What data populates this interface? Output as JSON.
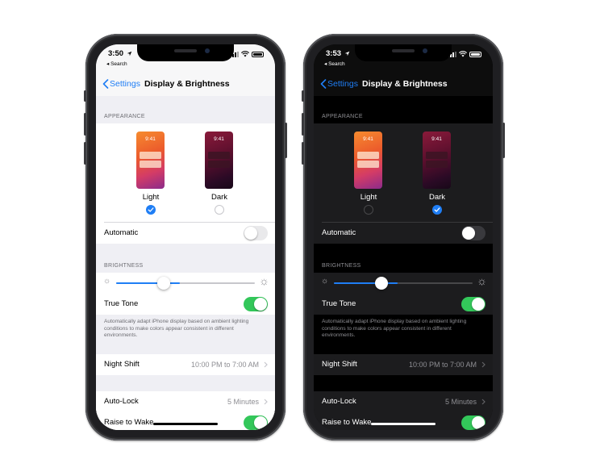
{
  "phones": [
    {
      "theme": "light",
      "status": {
        "time": "3:50",
        "back_app": "◂ Search"
      },
      "nav": {
        "back_label": "Settings",
        "title": "Display & Brightness"
      },
      "appearance": {
        "header": "APPEARANCE",
        "light_label": "Light",
        "dark_label": "Dark",
        "thumb_time": "9:41",
        "selected": "Light"
      },
      "automatic": {
        "label": "Automatic",
        "on": false
      },
      "brightness": {
        "header": "BRIGHTNESS",
        "level": 0.46
      },
      "true_tone": {
        "label": "True Tone",
        "on": true,
        "footer": "Automatically adapt iPhone display based on ambient lighting conditions to make colors appear consistent in different environments."
      },
      "night_shift": {
        "label": "Night Shift",
        "value": "10:00 PM to 7:00 AM"
      },
      "auto_lock": {
        "label": "Auto-Lock",
        "value": "5 Minutes"
      },
      "raise_to_wake": {
        "label": "Raise to Wake",
        "on": true
      }
    },
    {
      "theme": "dark",
      "status": {
        "time": "3:53",
        "back_app": "◂ Search"
      },
      "nav": {
        "back_label": "Settings",
        "title": "Display & Brightness"
      },
      "appearance": {
        "header": "APPEARANCE",
        "light_label": "Light",
        "dark_label": "Dark",
        "thumb_time": "9:41",
        "selected": "Dark"
      },
      "automatic": {
        "label": "Automatic",
        "on": false
      },
      "brightness": {
        "header": "BRIGHTNESS",
        "level": 0.46
      },
      "true_tone": {
        "label": "True Tone",
        "on": true,
        "footer": "Automatically adapt iPhone display based on ambient lighting conditions to make colors appear consistent in different environments."
      },
      "night_shift": {
        "label": "Night Shift",
        "value": "10:00 PM to 7:00 AM"
      },
      "auto_lock": {
        "label": "Auto-Lock",
        "value": "5 Minutes"
      },
      "raise_to_wake": {
        "label": "Raise to Wake",
        "on": true
      }
    }
  ],
  "icons": {
    "back": "chevron-left-icon",
    "disclosure": "chevron-right-icon",
    "location": "location-arrow-icon",
    "signal": "cellular-signal-icon",
    "wifi": "wifi-icon",
    "battery": "battery-icon",
    "sun_small": "sun-small-icon",
    "sun_large": "sun-large-icon",
    "checkmark": "checkmark-icon"
  },
  "colors": {
    "accent": "#1f7ef5",
    "toggle_on": "#33c75a"
  }
}
